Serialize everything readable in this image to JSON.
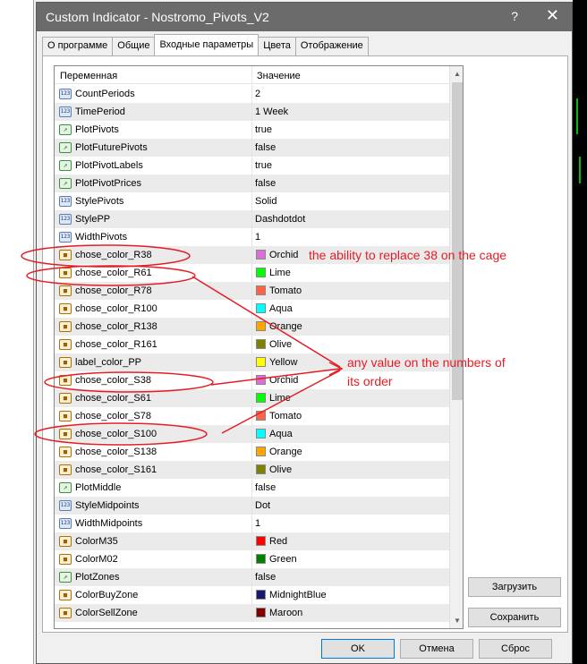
{
  "window": {
    "title": "Custom Indicator - Nostromo_Pivots_V2",
    "help_glyph": "?",
    "close_glyph": "✕"
  },
  "tabs": [
    {
      "label": "О программе"
    },
    {
      "label": "Общие"
    },
    {
      "label": "Входные параметры",
      "active": true
    },
    {
      "label": "Цвета"
    },
    {
      "label": "Отображение"
    }
  ],
  "grid": {
    "col_variable": "Переменная",
    "col_value": "Значение",
    "rows": [
      {
        "icon": "int-icon",
        "name": "CountPeriods",
        "value": "2"
      },
      {
        "icon": "int-icon",
        "name": "TimePeriod",
        "value": "1 Week"
      },
      {
        "icon": "bool-icon",
        "name": "PlotPivots",
        "value": "true"
      },
      {
        "icon": "bool-icon",
        "name": "PlotFuturePivots",
        "value": "false"
      },
      {
        "icon": "bool-icon",
        "name": "PlotPivotLabels",
        "value": "true"
      },
      {
        "icon": "bool-icon",
        "name": "PlotPivotPrices",
        "value": "false"
      },
      {
        "icon": "int-icon",
        "name": "StylePivots",
        "value": "Solid"
      },
      {
        "icon": "int-icon",
        "name": "StylePP",
        "value": "Dashdotdot"
      },
      {
        "icon": "int-icon",
        "name": "WidthPivots",
        "value": "1"
      },
      {
        "icon": "color-icon",
        "name": "chose_color_R38",
        "value": "Orchid",
        "color": "#da70d6"
      },
      {
        "icon": "color-icon",
        "name": "chose_color_R61",
        "value": "Lime",
        "color": "#00ff00"
      },
      {
        "icon": "color-icon",
        "name": "chose_color_R78",
        "value": "Tomato",
        "color": "#ff6347"
      },
      {
        "icon": "color-icon",
        "name": "chose_color_R100",
        "value": "Aqua",
        "color": "#00ffff"
      },
      {
        "icon": "color-icon",
        "name": "chose_color_R138",
        "value": "Orange",
        "color": "#ffa500"
      },
      {
        "icon": "color-icon",
        "name": "chose_color_R161",
        "value": "Olive",
        "color": "#808000"
      },
      {
        "icon": "color-icon",
        "name": "label_color_PP",
        "value": "Yellow",
        "color": "#ffff00"
      },
      {
        "icon": "color-icon",
        "name": "chose_color_S38",
        "value": "Orchid",
        "color": "#da70d6"
      },
      {
        "icon": "color-icon",
        "name": "chose_color_S61",
        "value": "Lime",
        "color": "#00ff00"
      },
      {
        "icon": "color-icon",
        "name": "chose_color_S78",
        "value": "Tomato",
        "color": "#ff6347"
      },
      {
        "icon": "color-icon",
        "name": "chose_color_S100",
        "value": "Aqua",
        "color": "#00ffff"
      },
      {
        "icon": "color-icon",
        "name": "chose_color_S138",
        "value": "Orange",
        "color": "#ffa500"
      },
      {
        "icon": "color-icon",
        "name": "chose_color_S161",
        "value": "Olive",
        "color": "#808000"
      },
      {
        "icon": "bool-icon",
        "name": "PlotMiddle",
        "value": "false"
      },
      {
        "icon": "int-icon",
        "name": "StyleMidpoints",
        "value": "Dot"
      },
      {
        "icon": "int-icon",
        "name": "WidthMidpoints",
        "value": "1"
      },
      {
        "icon": "color-icon",
        "name": "ColorM35",
        "value": "Red",
        "color": "#ff0000"
      },
      {
        "icon": "color-icon",
        "name": "ColorM02",
        "value": "Green",
        "color": "#008000"
      },
      {
        "icon": "bool-icon",
        "name": "PlotZones",
        "value": "false"
      },
      {
        "icon": "color-icon",
        "name": "ColorBuyZone",
        "value": "MidnightBlue",
        "color": "#191970"
      },
      {
        "icon": "color-icon",
        "name": "ColorSellZone",
        "value": "Maroon",
        "color": "#800000"
      }
    ]
  },
  "buttons": {
    "load": "Загрузить",
    "save": "Сохранить",
    "ok": "OK",
    "cancel": "Отмена",
    "reset": "Сброс"
  },
  "annotations": {
    "note1": "the ability to replace 38 on the cage",
    "note2_line1": "any value on the numbers of",
    "note2_line2": "its order",
    "color": "#e51c23"
  }
}
